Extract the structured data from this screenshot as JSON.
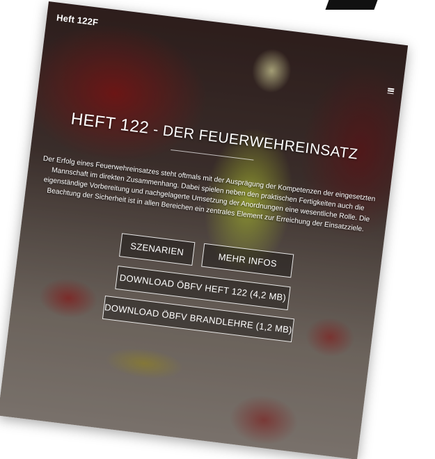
{
  "navbar": {
    "brand": "Heft 122F",
    "menu_icon": "hamburger-menu-icon"
  },
  "hero": {
    "title_main": "HEFT 122",
    "title_separator": " - ",
    "title_sub": "DER FEUERWEHREINSATZ",
    "intro": "Der Erfolg eines Feuerwehreinsatzes steht oftmals mit der Ausprägung der Kompetenzen der eingesetzten Mannschaft im direkten Zusammenhang. Dabei spielen neben den praktischen Fertigkeiten auch die eigenständige Vorbereitung und nachgelagerte Umsetzung der Anordnungen eine wesentliche Rolle. Die Beachtung der Sicherheit ist in allen Bereichen ein zentrales Element zur Erreichung der Einsatzziele."
  },
  "buttons": {
    "scenarios": "SZENARIEN",
    "more_info": "MEHR INFOS",
    "download_heft": "DOWNLOAD ÖBFV HEFT 122 (4,2 MB)",
    "download_brandlehre": "DOWNLOAD ÖBFV BRANDLEHRE (1,2 MB)"
  },
  "colors": {
    "text": "#ffffff",
    "button_border": "#ffffff",
    "vest": "#c8dc3c",
    "truck_red": "#8c1c1c"
  }
}
